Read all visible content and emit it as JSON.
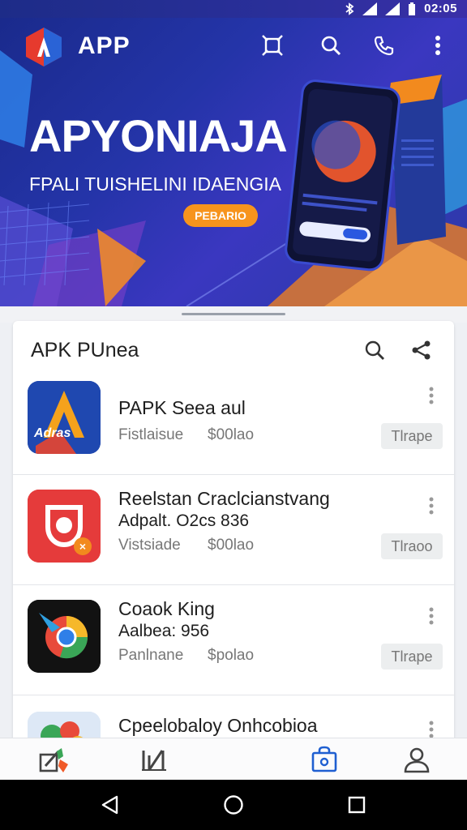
{
  "status_bar": {
    "time": "02:05"
  },
  "header": {
    "app_title": "APP"
  },
  "hero": {
    "headline": "APYONIAJA",
    "subtitle": "FPALI TUISHELINI IDAENGIA",
    "cta_label": "PEBARIO"
  },
  "list": {
    "title": "APK PUnea",
    "items": [
      {
        "title": "PAPK Seea aul",
        "subtitle": "",
        "category": "Fistlaisue",
        "price": "$00lao",
        "chip": "Tlrape"
      },
      {
        "title": "Reelstan  Craclcianstvang",
        "subtitle": "Adpalt. O2cs 836",
        "category": "Vistsiade",
        "price": "$00lao",
        "chip": "Tlraoo"
      },
      {
        "title": "Coaok King",
        "subtitle": "Aalbea: 956",
        "category": "Panlnane",
        "price": "$polao",
        "chip": "Tlrape"
      },
      {
        "title": "Cpeelobaloy Onhcobioa",
        "subtitle": "",
        "category": "",
        "price": "",
        "chip": ""
      }
    ],
    "first_icon_text": "Adras"
  },
  "colors": {
    "hero_blue": "#2434a8",
    "accent_orange": "#f7941d",
    "chip_bg": "#eceeef",
    "nav_active": "#1f5fd1"
  },
  "icons": {
    "header": [
      "crop-icon",
      "search-icon",
      "phone-icon",
      "more-vert-icon"
    ],
    "list_header": [
      "search-icon",
      "share-icon"
    ],
    "bottom_nav": [
      "edit-icon",
      "stats-icon",
      "bag-icon",
      "profile-icon"
    ],
    "system_nav": [
      "back-icon",
      "home-icon",
      "recents-icon"
    ]
  }
}
